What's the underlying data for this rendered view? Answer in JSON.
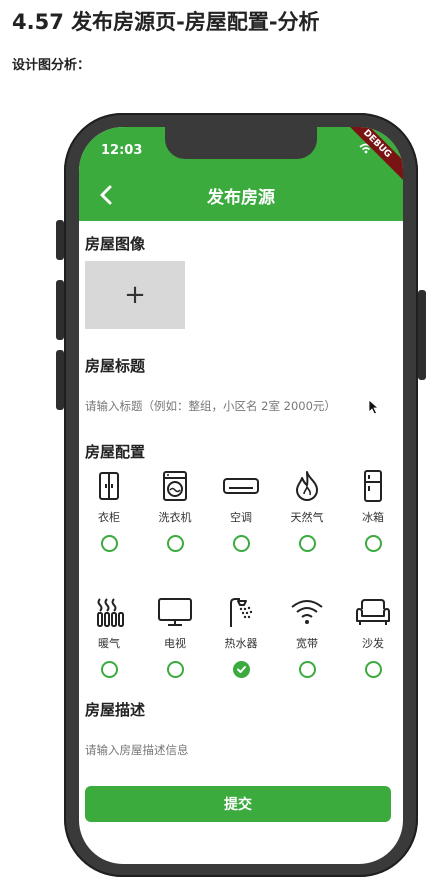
{
  "doc": {
    "title": "4.57 发布房源页-房屋配置-分析",
    "subtitle": "设计图分析："
  },
  "status_bar": {
    "time": "12:03",
    "debug_label": "DEBUG"
  },
  "app_bar": {
    "title": "发布房源",
    "color": "#3bab3e"
  },
  "image_section": {
    "title": "房屋图像",
    "add_symbol": "+"
  },
  "title_section": {
    "title": "房屋标题",
    "placeholder": "请输入标题（例如：整组，小区名 2室 2000元）"
  },
  "config_section": {
    "title": "房屋配置",
    "items": [
      {
        "label": "衣柜",
        "icon": "wardrobe-icon",
        "checked": false
      },
      {
        "label": "洗衣机",
        "icon": "washing-machine-icon",
        "checked": false
      },
      {
        "label": "空调",
        "icon": "air-conditioner-icon",
        "checked": false
      },
      {
        "label": "天然气",
        "icon": "gas-flame-icon",
        "checked": false
      },
      {
        "label": "冰箱",
        "icon": "fridge-icon",
        "checked": false
      },
      {
        "label": "暖气",
        "icon": "heater-icon",
        "checked": false
      },
      {
        "label": "电视",
        "icon": "tv-icon",
        "checked": false
      },
      {
        "label": "热水器",
        "icon": "water-heater-icon",
        "checked": true
      },
      {
        "label": "宽带",
        "icon": "wifi-icon",
        "checked": false
      },
      {
        "label": "沙发",
        "icon": "sofa-icon",
        "checked": false
      }
    ]
  },
  "desc_section": {
    "title": "房屋描述",
    "placeholder": "请输入房屋描述信息"
  },
  "submit": {
    "label": "提交"
  }
}
